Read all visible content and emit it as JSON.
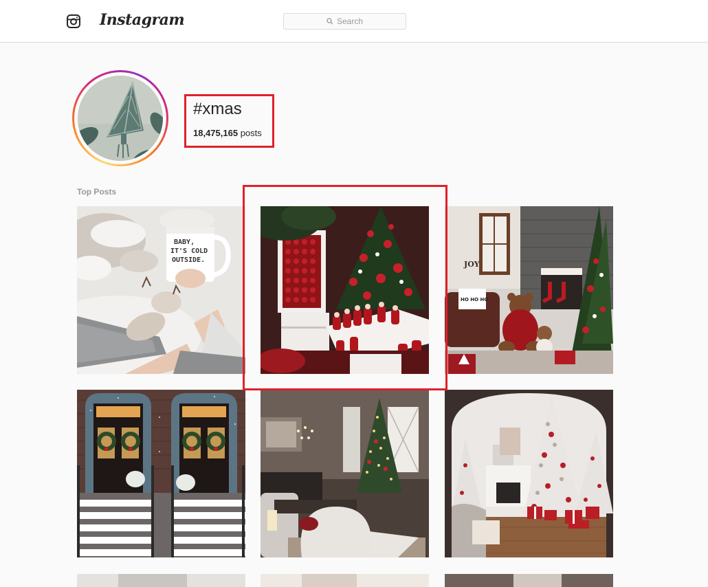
{
  "app": {
    "brand": "Instagram"
  },
  "search": {
    "placeholder": "Search"
  },
  "tag": {
    "name": "#xmas",
    "post_count": "18,475,165",
    "post_suffix": " posts"
  },
  "sections": {
    "top_posts": "Top Posts"
  },
  "posts": [
    {
      "mug_text_1": "BABY,",
      "mug_text_2": "IT'S COLD",
      "mug_text_3": "OUTSIDE."
    },
    {},
    {
      "joy": "JOY",
      "ho": "HO HO HO"
    },
    {},
    {},
    {}
  ],
  "colors": {
    "highlight": "#e0202a",
    "ring_start": "#feda75",
    "ring_end": "#962fbf"
  },
  "icons": [
    "instagram-glyph-icon",
    "search-icon"
  ]
}
